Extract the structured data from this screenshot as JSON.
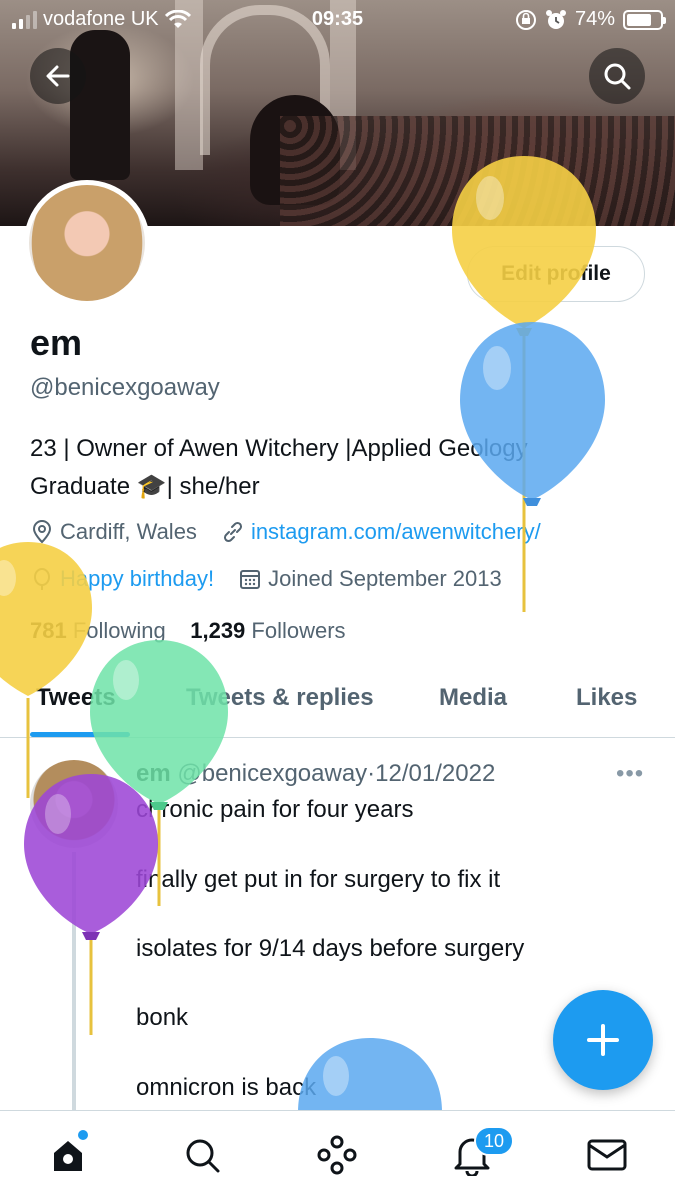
{
  "status_bar": {
    "carrier": "vodafone UK",
    "time": "09:35",
    "battery": "74%",
    "battery_level": 0.74
  },
  "header": {
    "back_icon": "arrow-left-icon",
    "search_icon": "search-icon"
  },
  "profile": {
    "edit_label": "Edit profile",
    "name": "em",
    "handle": "@benicexgoaway",
    "bio_line1": "23 | Owner of Awen Witchery |Applied Geology",
    "bio_line2": "Graduate 🎓| she/her",
    "location": "Cardiff, Wales",
    "website": "instagram.com/awenwitchery/",
    "birthday": "Happy birthday!",
    "joined": "Joined September 2013",
    "following_count": "781",
    "following_label": "Following",
    "followers_count": "1,239",
    "followers_label": "Followers"
  },
  "tabs": [
    {
      "label": "Tweets",
      "active": true
    },
    {
      "label": "Tweets & replies",
      "active": false
    },
    {
      "label": "Media",
      "active": false
    },
    {
      "label": "Likes",
      "active": false
    }
  ],
  "tweet": {
    "name": "em",
    "handle": "@benicexgoaway",
    "separator": "·",
    "date": "12/01/2022",
    "more": "•••",
    "lines": [
      "chronic pain for four years",
      "finally get put in for surgery to fix it",
      "isolates for 9/14 days before surgery",
      "bonk",
      "omnicron is back"
    ]
  },
  "bottom_nav": {
    "items": [
      "home-icon",
      "search-icon",
      "spaces-icon",
      "notifications-icon",
      "messages-icon"
    ],
    "notification_count": "10"
  },
  "colors": {
    "accent": "#1d9bf0",
    "balloon_yellow": "#f5cf45",
    "balloon_blue": "#5aa8f0",
    "balloon_green": "#6fe3a8",
    "balloon_purple": "#9d47d6"
  }
}
